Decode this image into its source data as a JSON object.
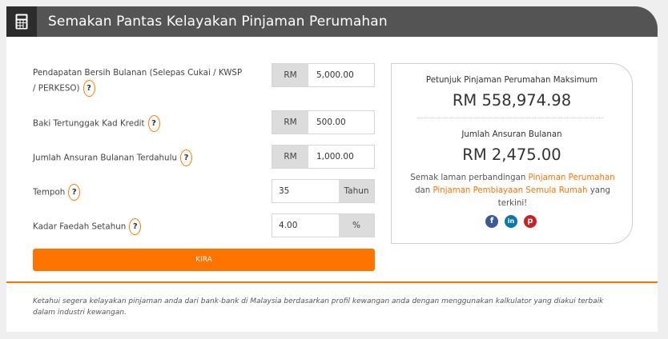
{
  "header": {
    "title": "Semakan Pantas Kelayakan Pinjaman Perumahan",
    "icon": "calculator-icon"
  },
  "form": {
    "income": {
      "label": "Pendapatan Bersih Bulanan (Selepas Cukai / KWSP / PERKESO)",
      "prefix": "RM",
      "value": "5,000.00"
    },
    "credit_card": {
      "label": "Baki Tertunggak Kad Kredit",
      "prefix": "RM",
      "value": "500.00"
    },
    "previous_installment": {
      "label": "Jumlah Ansuran Bulanan Terdahulu",
      "prefix": "RM",
      "value": "1,000.00"
    },
    "tenure": {
      "label": "Tempoh",
      "value": "35",
      "suffix": "Tahun"
    },
    "interest": {
      "label": "Kadar Faedah Setahun",
      "value": "4.00",
      "suffix": "%"
    },
    "help_symbol": "?",
    "submit_label": "KIRA"
  },
  "result": {
    "max_loan_label": "Petunjuk Pinjaman Perumahan Maksimum",
    "max_loan_value": "RM 558,974.98",
    "installment_label": "Jumlah Ansuran Bulanan",
    "installment_value": "RM 2,475.00",
    "compare_prefix": "Semak laman perbandingan",
    "compare_link1": "Pinjaman Perumahan",
    "compare_mid": "dan",
    "compare_link2": "Pinjaman Pembiayaan Semula Rumah",
    "compare_suffix": "yang terkini!"
  },
  "social": [
    {
      "name": "facebook",
      "glyph": "f",
      "color": "#3b5998"
    },
    {
      "name": "linkedin",
      "glyph": "in",
      "color": "#0e76a8"
    },
    {
      "name": "pinterest",
      "glyph": "p",
      "color": "#cb2027"
    }
  ],
  "footnote": "Ketahui segera kelayakan pinjaman anda dari bank-bank di Malaysia berdasarkan profil kewangan anda dengan menggunakan kalkulator yang diakui terbaik dalam industri kewangan.",
  "colors": {
    "accent": "#ff7300",
    "header_bg": "#545454",
    "header_icon_bg": "#2c2c2c"
  }
}
